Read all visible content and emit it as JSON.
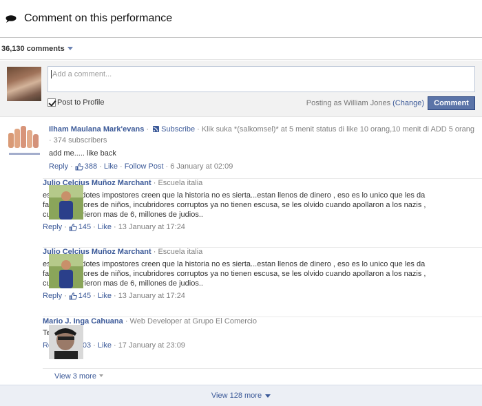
{
  "header": {
    "title": "Comment on this performance",
    "icon": "speech-bubble-icon"
  },
  "comments_count": {
    "label": "36,130 comments"
  },
  "compose": {
    "placeholder": "Add a comment...",
    "post_to_profile_label": "Post to Profile",
    "post_to_profile_checked": true,
    "posting_as_prefix": "Posting as William Jones",
    "change_label": "(Change)",
    "comment_button": "Comment"
  },
  "comments": [
    {
      "author": "Ilham Maulana Mark'evans",
      "subscribe_label": "Subscribe",
      "meta_sep": "·",
      "meta": "· Klik suka *(salkomsel)* at 5 menit status di like 10 orang,10 menit di ADD 5 orang · 374 subscribers",
      "text": "add me..... like back",
      "reply_label": "Reply",
      "likes": "388",
      "like_label": "Like",
      "follow_label": "Follow Post",
      "time": "6 January at 02:09"
    },
    {
      "author": "Julio Celcius Muñoz Marchant",
      "meta": "· Escuela italia",
      "text": "estos sacerdotes impostores creen que la historia no es sierta...estan llenos de dinero , eso es lo unico que les da fama .violadores de niños, incubridores corruptos ya no tienen escusa, se les olvido cuando apollaron a los nazis , cuantos murieron mas de 6, millones de judios..",
      "reply_label": "Reply",
      "likes": "145",
      "like_label": "Like",
      "time": "13 January at 17:24"
    },
    {
      "author": "Julio Celcius Muñoz Marchant",
      "meta": "· Escuela italia",
      "text": "estos sacerdotes impostores creen que la historia no es sierta...estan llenos de dinero , eso es lo unico que les da fama .violadores de niños, incubridores corruptos ya no tienen escusa, se les olvido cuando apollaron a los nazis , cuantos murieron mas de 6, millones de judios..",
      "reply_label": "Reply",
      "likes": "145",
      "like_label": "Like",
      "time": "13 January at 17:24"
    },
    {
      "author": "Mario J. Inga Cahuana",
      "meta": "· Web Developer at Grupo El Comercio",
      "text": "Test",
      "reply_label": "Reply",
      "likes": "203",
      "like_label": "Like",
      "time": "17 January at 23:09"
    }
  ],
  "view_more_replies": "View 3 more",
  "view_more_comments": "View 128 more",
  "colors": {
    "link": "#3b5998",
    "button": "#5b74a8",
    "footer_bg": "#eceff5"
  }
}
